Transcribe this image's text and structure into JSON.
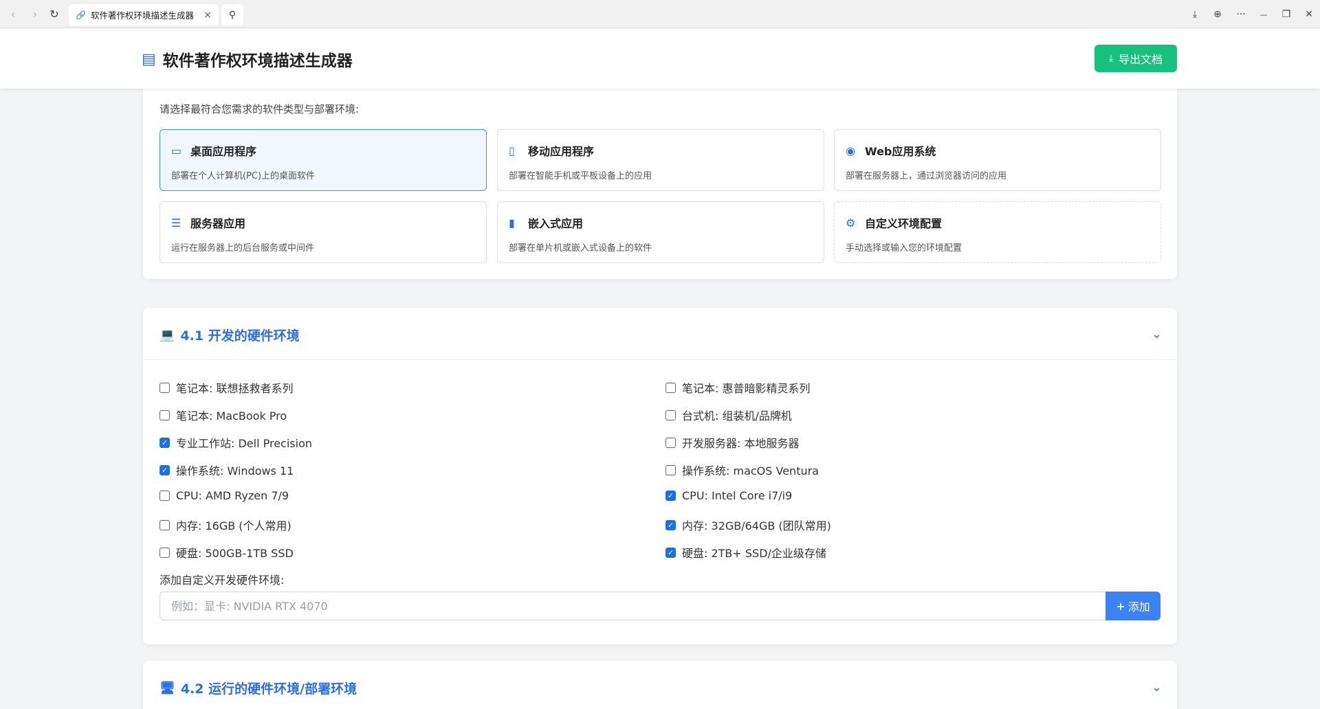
{
  "browser": {
    "tab_title": "软件著作权环境描述生成器",
    "nav_back": "‹",
    "nav_forward": "›",
    "reload": "↻",
    "close": "×",
    "search": "⚲",
    "download": "⤓",
    "globe": "⊕",
    "more": "···",
    "minimize": "—",
    "restore": "❐",
    "window_close": "✕"
  },
  "header": {
    "title": "软件著作权环境描述生成器",
    "export_label": "导出文档",
    "export_icon": "⤓",
    "doc_icon": "▤"
  },
  "types": {
    "prompt": "请选择最符合您需求的软件类型与部署环境:",
    "items": [
      {
        "icon": "▭",
        "title": "桌面应用程序",
        "desc": "部署在个人计算机(PC)上的桌面软件"
      },
      {
        "icon": "▯",
        "title": "移动应用程序",
        "desc": "部署在智能手机或平板设备上的应用"
      },
      {
        "icon": "◉",
        "title": "Web应用系统",
        "desc": "部署在服务器上，通过浏览器访问的应用"
      },
      {
        "icon": "☰",
        "title": "服务器应用",
        "desc": "运行在服务器上的后台服务或中间件"
      },
      {
        "icon": "▮",
        "title": "嵌入式应用",
        "desc": "部署在单片机或嵌入式设备上的软件"
      },
      {
        "icon": "⚙",
        "title": "自定义环境配置",
        "desc": "手动选择或输入您的环境配置"
      }
    ]
  },
  "dev_hw": {
    "title": "4.1 开发的硬件环境",
    "icon": "💻",
    "chevron": "⌄",
    "left_options": [
      {
        "label": "笔记本: 联想拯救者系列",
        "checked": false
      },
      {
        "label": "笔记本: MacBook Pro",
        "checked": false
      },
      {
        "label": "专业工作站: Dell Precision",
        "checked": true
      },
      {
        "label": "操作系统: Windows 11",
        "checked": true
      },
      {
        "label": "CPU: AMD Ryzen 7/9",
        "checked": false
      },
      {
        "label": "内存: 16GB (个人常用)",
        "checked": false
      },
      {
        "label": "硬盘: 500GB-1TB SSD",
        "checked": false
      }
    ],
    "right_options": [
      {
        "label": "笔记本: 惠普暗影精灵系列",
        "checked": false
      },
      {
        "label": "台式机: 组装机/品牌机",
        "checked": false
      },
      {
        "label": "开发服务器: 本地服务器",
        "checked": false
      },
      {
        "label": "操作系统: macOS Ventura",
        "checked": false
      },
      {
        "label": "CPU: Intel Core i7/i9",
        "checked": true
      },
      {
        "label": "内存: 32GB/64GB (团队常用)",
        "checked": true
      },
      {
        "label": "硬盘: 2TB+ SSD/企业级存储",
        "checked": true
      }
    ],
    "custom_label": "添加自定义开发硬件环境:",
    "custom_placeholder": "例如：显卡: NVIDIA RTX 4070",
    "add_label": "添加",
    "add_icon": "+"
  },
  "run_hw": {
    "title": "4.2 运行的硬件环境/部署环境",
    "icon": "🖥",
    "chevron": "⌄"
  }
}
